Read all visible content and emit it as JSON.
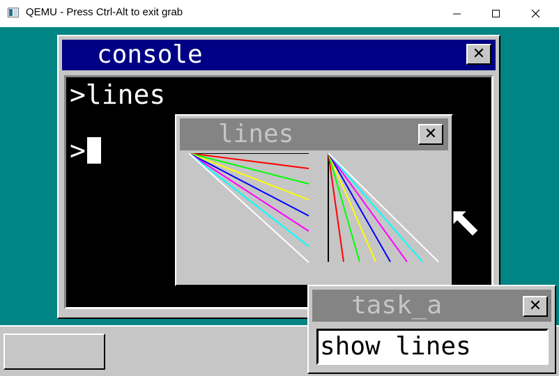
{
  "host_window": {
    "title": "QEMU - Press Ctrl-Alt to exit grab",
    "icons": [
      "qemu-app-icon",
      "minimize-icon",
      "maximize-icon",
      "close-icon"
    ]
  },
  "console": {
    "title": "console",
    "lines": [
      ">lines",
      ">"
    ],
    "close_icon": "close-icon"
  },
  "lines_window": {
    "title": "lines",
    "close_icon": "close-icon",
    "line_colors": [
      "#000000",
      "#ff0000",
      "#00ff00",
      "#ffff00",
      "#0000ff",
      "#ff00ff",
      "#00ffff",
      "#ffffff"
    ]
  },
  "task_a": {
    "title": "task_a",
    "input_value": "show lines",
    "close_icon": "close-icon"
  },
  "colors": {
    "desktop": "#008484",
    "active_title": "#000084",
    "inactive_title": "#848484",
    "window_face": "#c6c6c6"
  }
}
